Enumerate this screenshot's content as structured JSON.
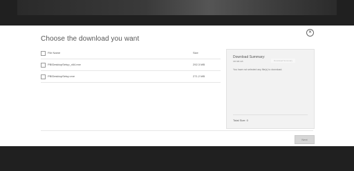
{
  "modal": {
    "title": "Choose the download you want",
    "close_glyph": "✕"
  },
  "table": {
    "header": {
      "name": "File Name",
      "size": "Size"
    },
    "rows": [
      {
        "name": "PBIDesktopSetup_x64.exe",
        "size": "292.3 MB"
      },
      {
        "name": "PBIDesktopSetup.exe",
        "size": "271.2 MB"
      }
    ]
  },
  "summary": {
    "title": "Download Summary:",
    "subtitle": "KB MB GB",
    "message": "You have not selected any file(s) to download.",
    "floating_label": "Download Summary",
    "total": "Total Size: 0"
  },
  "footer": {
    "next_label": "Next"
  },
  "colors": {
    "modal_bg": "#ffffff",
    "summary_bg": "#f2f2f2",
    "next_bg": "#d6d6d6"
  },
  "icons": [
    "close-icon",
    "checkbox-icon"
  ]
}
